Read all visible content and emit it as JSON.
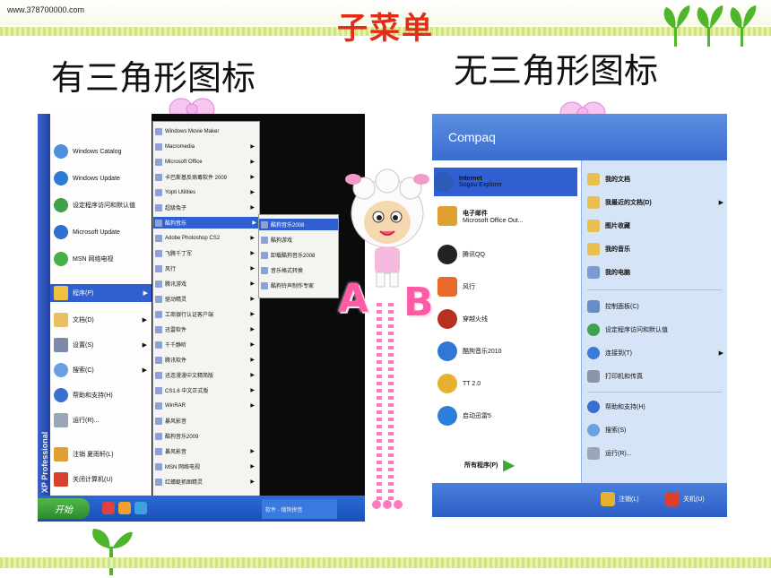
{
  "site_url": "www.378700000.com",
  "title": "子菜单",
  "heading_left": "有三角形图标",
  "heading_right": "无三角形图标",
  "label_a": "A",
  "label_b": "B",
  "left_shot": {
    "os_label": "Windows XP Professional",
    "panel_items": [
      "Windows Catalog",
      "Windows Update",
      "设定程序访问和默认值",
      "Microsoft Update",
      "MSN 网络电视",
      "程序(P)",
      "文档(D)",
      "设置(S)",
      "搜索(C)",
      "帮助和支持(H)",
      "运行(R)...",
      "注销 夏雨轩(L)",
      "关闭计算机(U)"
    ],
    "programs_menu": [
      "Windows Movie Maker",
      "Macromedia",
      "Microsoft Office",
      "卡巴斯基反病毒软件 2009",
      "Yopti Utilities",
      "超级兔子",
      "酷狗音乐",
      "Adobe Photoshop CS2",
      "飞腾千丁军",
      "风行",
      "腾讯游戏",
      "驱动精灵",
      "工商银行认证客户端",
      "迅雷软件",
      "千千静听",
      "腾讯软件",
      "迅连漫漫中文精简版",
      "CS1.6 中文正式版",
      "WinRAR",
      "暴风影音",
      "酷狗音乐2009",
      "暴风影音",
      "MSN 网络电视",
      "红蜻蜓抓图精灵"
    ],
    "kugou_submenu": [
      "酷狗音乐2008",
      "酷狗游戏",
      "卸载酷狗音乐2008",
      "音乐格式转换",
      "酷狗铃声制作专家"
    ],
    "start_label": "开始",
    "task_button": "软件 - 搜狗拼音"
  },
  "right_shot": {
    "header": "Compaq",
    "left_items": [
      {
        "title": "Internet",
        "sub": "Sogou Explorer"
      },
      {
        "title": "电子邮件",
        "sub": "Microsoft Office Out..."
      },
      {
        "title": "腾讯QQ",
        "sub": ""
      },
      {
        "title": "风行",
        "sub": ""
      },
      {
        "title": "穿越火线",
        "sub": ""
      },
      {
        "title": "酷狗音乐2010",
        "sub": ""
      },
      {
        "title": "TT 2.0",
        "sub": ""
      },
      {
        "title": "启动迅雷5",
        "sub": ""
      }
    ],
    "all_programs": "所有程序(P)",
    "right_items": [
      "我的文档",
      "我最近的文档(D)",
      "图片收藏",
      "我的音乐",
      "我的电脑",
      "控制面板(C)",
      "设定程序访问和默认值",
      "连接到(T)",
      "打印机和传真",
      "帮助和支持(H)",
      "搜索(S)",
      "运行(R)..."
    ],
    "logoff": "注销(L)",
    "shutdown": "关机(U)"
  },
  "colors": {
    "title_red": "#e32c17",
    "accent_pink": "#ff5aa5",
    "xp_blue": "#2f5fd0",
    "leaf_green": "#4fb52a"
  }
}
